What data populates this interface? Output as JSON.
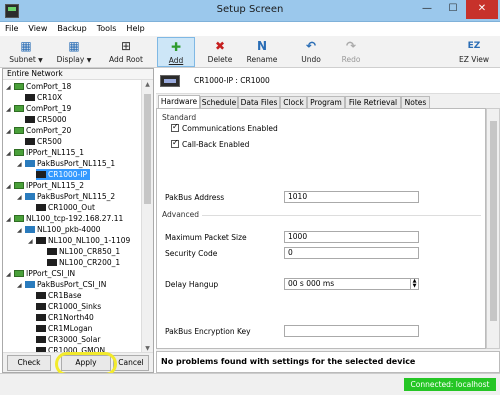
{
  "window": {
    "title": "Setup Screen"
  },
  "menu": [
    "File",
    "View",
    "Backup",
    "Tools",
    "Help"
  ],
  "toolbar": {
    "subnet": "Subnet",
    "display": "Display",
    "add_root": "Add Root",
    "add": "Add",
    "delete": "Delete",
    "rename": "Rename",
    "undo": "Undo",
    "redo": "Redo",
    "ez_view": "EZ View"
  },
  "tree": {
    "header": "Entire Network",
    "nodes": [
      "ComPort_18",
      "CR10X",
      "ComPort_19",
      "CR5000",
      "ComPort_20",
      "CR500",
      "IPPort_NL115_1",
      "PakBusPort_NL115_1",
      "CR1000-IP",
      "IPPort_NL115_2",
      "PakBusPort_NL115_2",
      "CR1000_Out",
      "NL100_tcp-192.168.27.11",
      "NL100_pkb-4000",
      "NL100_NL100_1-1109",
      "NL100_CR850_1",
      "NL100_CR200_1",
      "IPPort_CSI_IN",
      "PakBusPort_CSI_IN",
      "CR1Base",
      "CR1000_Sinks",
      "CR1North40",
      "CR1MLogan",
      "CR3000_Solar",
      "CR1000_GMON"
    ]
  },
  "buttons": {
    "check": "Check",
    "apply": "Apply",
    "cancel": "Cancel"
  },
  "device": {
    "header": "CR1000-IP : CR1000"
  },
  "tabs": [
    "Hardware",
    "Schedule",
    "Data Files",
    "Clock",
    "Program",
    "File Retrieval",
    "Notes"
  ],
  "hardware": {
    "standard_label": "Standard",
    "comm_enabled_label": "Communications Enabled",
    "callback_enabled_label": "Call-Back Enabled",
    "pakbus_address_label": "PakBus Address",
    "pakbus_address_value": "1010",
    "advanced_label": "Advanced",
    "max_packet_label": "Maximum Packet Size",
    "max_packet_value": "1000",
    "security_code_label": "Security Code",
    "security_code_value": "0",
    "delay_hangup_label": "Delay Hangup",
    "delay_hangup_value": "00 s 000 ms",
    "encryption_key_label": "PakBus Encryption Key",
    "encryption_key_value": ""
  },
  "status_message": "No problems found with settings for the selected device",
  "connection_status": "Connected: localhost",
  "colors": {
    "connected": "#25c625",
    "selection": "#3399ff",
    "highlight_ring": "#f2ea2c"
  }
}
